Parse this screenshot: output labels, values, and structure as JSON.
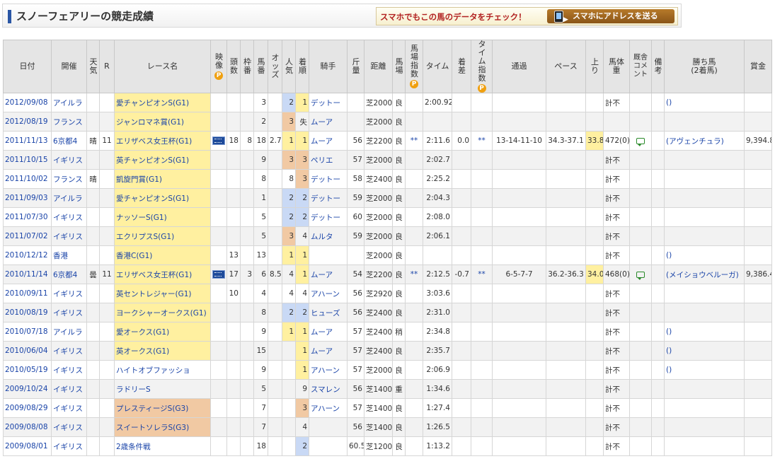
{
  "header": {
    "title": "スノーフェアリーの競走成績",
    "promo_text": "スマホでもこの馬のデータをチェック！",
    "promo_button": "スマホにアドレスを送る"
  },
  "columns": {
    "date": "日付",
    "venue": "開催",
    "weather": "天気",
    "race_no": "R",
    "race_name": "レース名",
    "video": "映像",
    "heads": "頭数",
    "bracket": "枠番",
    "horse_no": "馬番",
    "odds": "オッズ",
    "popularity": "人気",
    "finish": "着順",
    "jockey": "騎手",
    "weight": "斤量",
    "distance": "距離",
    "track": "馬場",
    "track_index": "馬場指数",
    "time": "タイム",
    "margin": "着差",
    "time_index": "タイム指数",
    "passing": "通過",
    "pace": "ペース",
    "last3f": "上り",
    "body_weight": "馬体重",
    "stable_comment": "厩舎コメント",
    "remarks": "備考",
    "winner_line1": "勝ち馬",
    "winner_line2": "(2着馬)",
    "prize": "賞金"
  },
  "icons": {
    "premium": "P"
  },
  "rows": [
    {
      "date": "2012/09/08",
      "venue": "アイルラ",
      "weather": "",
      "race_no": "",
      "race_name": "愛チャンピオンS(G1)",
      "grade": "G1",
      "video": false,
      "heads": "",
      "bracket": "",
      "horse_no": "3",
      "odds": "",
      "popularity": "2",
      "finish": "1",
      "jockey": "デットー",
      "weight": "",
      "distance": "芝2000",
      "track": "良",
      "track_index": "",
      "time": "2:00.92",
      "margin": "",
      "time_index": "",
      "passing": "",
      "pace": "",
      "last3f": "",
      "body_weight": "計不",
      "comment": false,
      "remarks": "",
      "winner": "()",
      "prize": ""
    },
    {
      "date": "2012/08/19",
      "venue": "フランス",
      "weather": "",
      "race_no": "",
      "race_name": "ジャンロマネ賞(G1)",
      "grade": "G1",
      "video": false,
      "heads": "",
      "bracket": "",
      "horse_no": "2",
      "odds": "",
      "popularity": "3",
      "finish": "失",
      "jockey": "ムーア",
      "weight": "",
      "distance": "芝2000",
      "track": "良",
      "track_index": "",
      "time": "",
      "margin": "",
      "time_index": "",
      "passing": "",
      "pace": "",
      "last3f": "",
      "body_weight": "",
      "comment": false,
      "remarks": "",
      "winner": "",
      "prize": ""
    },
    {
      "date": "2011/11/13",
      "venue": "6京都4",
      "weather": "晴",
      "race_no": "11",
      "race_name": "エリザベス女王杯(G1)",
      "grade": "G1",
      "video": true,
      "heads": "18",
      "bracket": "8",
      "horse_no": "18",
      "odds": "2.7",
      "popularity": "1",
      "finish": "1",
      "jockey": "ムーア",
      "weight": "56",
      "distance": "芝2200",
      "track": "良",
      "track_index": "**",
      "time": "2:11.6",
      "margin": "0.0",
      "time_index": "**",
      "passing": "13-14-11-10",
      "pace": "34.3-37.1",
      "last3f": "33.8",
      "body_weight": "472(0)",
      "comment": true,
      "remarks": "",
      "winner": "(アヴェンチュラ)",
      "prize": "9,394.8"
    },
    {
      "date": "2011/10/15",
      "venue": "イギリス",
      "weather": "",
      "race_no": "",
      "race_name": "英チャンピオンS(G1)",
      "grade": "G1",
      "video": false,
      "heads": "",
      "bracket": "",
      "horse_no": "9",
      "odds": "",
      "popularity": "3",
      "finish": "3",
      "jockey": "ペリエ",
      "weight": "57",
      "distance": "芝2000",
      "track": "良",
      "track_index": "",
      "time": "2:02.7",
      "margin": "",
      "time_index": "",
      "passing": "",
      "pace": "",
      "last3f": "",
      "body_weight": "計不",
      "comment": false,
      "remarks": "",
      "winner": "",
      "prize": ""
    },
    {
      "date": "2011/10/02",
      "venue": "フランス",
      "weather": "晴",
      "race_no": "",
      "race_name": "凱旋門賞(G1)",
      "grade": "G1",
      "video": false,
      "heads": "",
      "bracket": "",
      "horse_no": "8",
      "odds": "",
      "popularity": "8",
      "finish": "3",
      "jockey": "デットー",
      "weight": "58",
      "distance": "芝2400",
      "track": "良",
      "track_index": "",
      "time": "2:25.2",
      "margin": "",
      "time_index": "",
      "passing": "",
      "pace": "",
      "last3f": "",
      "body_weight": "計不",
      "comment": false,
      "remarks": "",
      "winner": "",
      "prize": ""
    },
    {
      "date": "2011/09/03",
      "venue": "アイルラ",
      "weather": "",
      "race_no": "",
      "race_name": "愛チャンピオンS(G1)",
      "grade": "G1",
      "video": false,
      "heads": "",
      "bracket": "",
      "horse_no": "1",
      "odds": "",
      "popularity": "2",
      "finish": "2",
      "jockey": "デットー",
      "weight": "59",
      "distance": "芝2000",
      "track": "良",
      "track_index": "",
      "time": "2:04.3",
      "margin": "",
      "time_index": "",
      "passing": "",
      "pace": "",
      "last3f": "",
      "body_weight": "計不",
      "comment": false,
      "remarks": "",
      "winner": "",
      "prize": ""
    },
    {
      "date": "2011/07/30",
      "venue": "イギリス",
      "weather": "",
      "race_no": "",
      "race_name": "ナッソーS(G1)",
      "grade": "G1",
      "video": false,
      "heads": "",
      "bracket": "",
      "horse_no": "5",
      "odds": "",
      "popularity": "2",
      "finish": "2",
      "jockey": "デットー",
      "weight": "60",
      "distance": "芝2000",
      "track": "良",
      "track_index": "",
      "time": "2:08.0",
      "margin": "",
      "time_index": "",
      "passing": "",
      "pace": "",
      "last3f": "",
      "body_weight": "計不",
      "comment": false,
      "remarks": "",
      "winner": "",
      "prize": ""
    },
    {
      "date": "2011/07/02",
      "venue": "イギリス",
      "weather": "",
      "race_no": "",
      "race_name": "エクリプスS(G1)",
      "grade": "G1",
      "video": false,
      "heads": "",
      "bracket": "",
      "horse_no": "5",
      "odds": "",
      "popularity": "3",
      "finish": "4",
      "jockey": "ムルタ",
      "weight": "59",
      "distance": "芝2000",
      "track": "良",
      "track_index": "",
      "time": "2:06.1",
      "margin": "",
      "time_index": "",
      "passing": "",
      "pace": "",
      "last3f": "",
      "body_weight": "計不",
      "comment": false,
      "remarks": "",
      "winner": "",
      "prize": ""
    },
    {
      "date": "2010/12/12",
      "venue": "香港",
      "weather": "",
      "race_no": "",
      "race_name": "香港C(G1)",
      "grade": "G1",
      "video": false,
      "heads": "13",
      "bracket": "",
      "horse_no": "13",
      "odds": "",
      "popularity": "1",
      "finish": "1",
      "jockey": "",
      "weight": "",
      "distance": "芝2000",
      "track": "良",
      "track_index": "",
      "time": "",
      "margin": "",
      "time_index": "",
      "passing": "",
      "pace": "",
      "last3f": "",
      "body_weight": "計不",
      "comment": false,
      "remarks": "",
      "winner": "()",
      "prize": ""
    },
    {
      "date": "2010/11/14",
      "venue": "6京都4",
      "weather": "曇",
      "race_no": "11",
      "race_name": "エリザベス女王杯(G1)",
      "grade": "G1",
      "video": true,
      "heads": "17",
      "bracket": "3",
      "horse_no": "6",
      "odds": "8.5",
      "popularity": "4",
      "finish": "1",
      "jockey": "ムーア",
      "weight": "54",
      "distance": "芝2200",
      "track": "良",
      "track_index": "**",
      "time": "2:12.5",
      "margin": "-0.7",
      "time_index": "**",
      "passing": "6-5-7-7",
      "pace": "36.2-36.3",
      "last3f": "34.0",
      "body_weight": "468(0)",
      "comment": true,
      "remarks": "",
      "winner": "(メイショウベルーガ)",
      "prize": "9,386.4"
    },
    {
      "date": "2010/09/11",
      "venue": "イギリス",
      "weather": "",
      "race_no": "",
      "race_name": "英セントレジャー(G1)",
      "grade": "G1",
      "video": false,
      "heads": "10",
      "bracket": "",
      "horse_no": "4",
      "odds": "",
      "popularity": "4",
      "finish": "4",
      "jockey": "アハーン",
      "weight": "56",
      "distance": "芝2920",
      "track": "良",
      "track_index": "",
      "time": "3:03.6",
      "margin": "",
      "time_index": "",
      "passing": "",
      "pace": "",
      "last3f": "",
      "body_weight": "計不",
      "comment": false,
      "remarks": "",
      "winner": "",
      "prize": ""
    },
    {
      "date": "2010/08/19",
      "venue": "イギリス",
      "weather": "",
      "race_no": "",
      "race_name": "ヨークシャーオークス(G1)",
      "grade": "G1",
      "video": false,
      "heads": "",
      "bracket": "",
      "horse_no": "8",
      "odds": "",
      "popularity": "2",
      "finish": "2",
      "jockey": "ヒューズ",
      "weight": "56",
      "distance": "芝2400",
      "track": "良",
      "track_index": "",
      "time": "2:31.0",
      "margin": "",
      "time_index": "",
      "passing": "",
      "pace": "",
      "last3f": "",
      "body_weight": "計不",
      "comment": false,
      "remarks": "",
      "winner": "",
      "prize": ""
    },
    {
      "date": "2010/07/18",
      "venue": "アイルラ",
      "weather": "",
      "race_no": "",
      "race_name": "愛オークス(G1)",
      "grade": "G1",
      "video": false,
      "heads": "",
      "bracket": "",
      "horse_no": "9",
      "odds": "",
      "popularity": "1",
      "finish": "1",
      "jockey": "ムーア",
      "weight": "57",
      "distance": "芝2400",
      "track": "稍",
      "track_index": "",
      "time": "2:34.8",
      "margin": "",
      "time_index": "",
      "passing": "",
      "pace": "",
      "last3f": "",
      "body_weight": "計不",
      "comment": false,
      "remarks": "",
      "winner": "()",
      "prize": ""
    },
    {
      "date": "2010/06/04",
      "venue": "イギリス",
      "weather": "",
      "race_no": "",
      "race_name": "英オークス(G1)",
      "grade": "G1",
      "video": false,
      "heads": "",
      "bracket": "",
      "horse_no": "15",
      "odds": "",
      "popularity": "",
      "finish": "1",
      "jockey": "ムーア",
      "weight": "57",
      "distance": "芝2400",
      "track": "良",
      "track_index": "",
      "time": "2:35.7",
      "margin": "",
      "time_index": "",
      "passing": "",
      "pace": "",
      "last3f": "",
      "body_weight": "計不",
      "comment": false,
      "remarks": "",
      "winner": "()",
      "prize": ""
    },
    {
      "date": "2010/05/19",
      "venue": "イギリス",
      "weather": "",
      "race_no": "",
      "race_name": "ハイトオブファッショ",
      "grade": "",
      "video": false,
      "heads": "",
      "bracket": "",
      "horse_no": "9",
      "odds": "",
      "popularity": "",
      "finish": "1",
      "jockey": "アハーン",
      "weight": "57",
      "distance": "芝2000",
      "track": "良",
      "track_index": "",
      "time": "2:06.9",
      "margin": "",
      "time_index": "",
      "passing": "",
      "pace": "",
      "last3f": "",
      "body_weight": "計不",
      "comment": false,
      "remarks": "",
      "winner": "()",
      "prize": ""
    },
    {
      "date": "2009/10/24",
      "venue": "イギリス",
      "weather": "",
      "race_no": "",
      "race_name": "ラドリーS",
      "grade": "",
      "video": false,
      "heads": "",
      "bracket": "",
      "horse_no": "5",
      "odds": "",
      "popularity": "",
      "finish": "9",
      "jockey": "スマレン",
      "weight": "56",
      "distance": "芝1400",
      "track": "重",
      "track_index": "",
      "time": "1:34.6",
      "margin": "",
      "time_index": "",
      "passing": "",
      "pace": "",
      "last3f": "",
      "body_weight": "計不",
      "comment": false,
      "remarks": "",
      "winner": "",
      "prize": ""
    },
    {
      "date": "2009/08/29",
      "venue": "イギリス",
      "weather": "",
      "race_no": "",
      "race_name": "プレスティージS(G3)",
      "grade": "G3",
      "video": false,
      "heads": "",
      "bracket": "",
      "horse_no": "7",
      "odds": "",
      "popularity": "",
      "finish": "3",
      "jockey": "アハーン",
      "weight": "57",
      "distance": "芝1400",
      "track": "良",
      "track_index": "",
      "time": "1:27.4",
      "margin": "",
      "time_index": "",
      "passing": "",
      "pace": "",
      "last3f": "",
      "body_weight": "計不",
      "comment": false,
      "remarks": "",
      "winner": "",
      "prize": ""
    },
    {
      "date": "2009/08/08",
      "venue": "イギリス",
      "weather": "",
      "race_no": "",
      "race_name": "スイートソレラS(G3)",
      "grade": "G3",
      "video": false,
      "heads": "",
      "bracket": "",
      "horse_no": "7",
      "odds": "",
      "popularity": "",
      "finish": "4",
      "jockey": "",
      "weight": "56",
      "distance": "芝1400",
      "track": "良",
      "track_index": "",
      "time": "1:26.5",
      "margin": "",
      "time_index": "",
      "passing": "",
      "pace": "",
      "last3f": "",
      "body_weight": "計不",
      "comment": false,
      "remarks": "",
      "winner": "",
      "prize": ""
    },
    {
      "date": "2009/08/01",
      "venue": "イギリス",
      "weather": "",
      "race_no": "",
      "race_name": "2歳条件戦",
      "grade": "",
      "video": false,
      "heads": "",
      "bracket": "",
      "horse_no": "18",
      "odds": "",
      "popularity": "",
      "finish": "2",
      "jockey": "",
      "weight": "60.5",
      "distance": "芝1200",
      "track": "良",
      "track_index": "",
      "time": "1:13.2",
      "margin": "",
      "time_index": "",
      "passing": "",
      "pace": "",
      "last3f": "",
      "body_weight": "計不",
      "comment": false,
      "remarks": "",
      "winner": "",
      "prize": ""
    }
  ],
  "colors": {
    "header_bg": "#e5e5e5",
    "g1_bg": "#fff0a0",
    "g3_bg": "#f1c9a3",
    "rank2_bg": "#c9d9f5",
    "link": "#1a44a8",
    "title_accent": "#2a56a5"
  }
}
